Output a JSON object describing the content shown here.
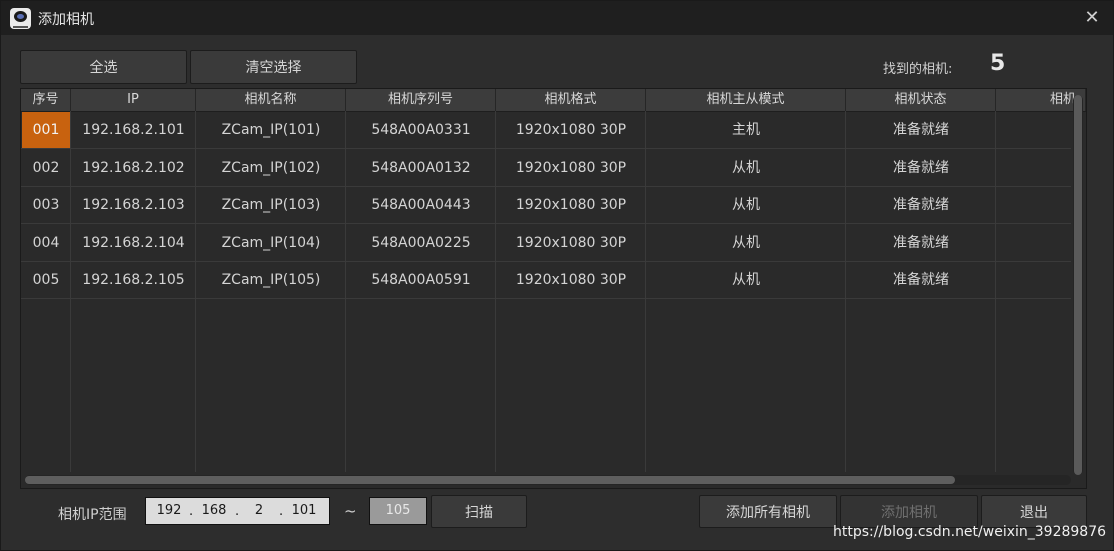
{
  "window": {
    "title": "添加相机",
    "close_glyph": "✕"
  },
  "toolbar": {
    "select_all": "全选",
    "clear_selection": "清空选择"
  },
  "found": {
    "label": "找到的相机:",
    "count": "5"
  },
  "table": {
    "headers": [
      "序号",
      "IP",
      "相机名称",
      "相机序列号",
      "相机格式",
      "相机主从模式",
      "相机状态",
      "相机"
    ],
    "rows": [
      [
        "001",
        "192.168.2.101",
        "ZCam_IP(101)",
        "548A00A0331",
        "1920x1080 30P",
        "主机",
        "准备就绪"
      ],
      [
        "002",
        "192.168.2.102",
        "ZCam_IP(102)",
        "548A00A0132",
        "1920x1080 30P",
        "从机",
        "准备就绪"
      ],
      [
        "003",
        "192.168.2.103",
        "ZCam_IP(103)",
        "548A00A0443",
        "1920x1080 30P",
        "从机",
        "准备就绪"
      ],
      [
        "004",
        "192.168.2.104",
        "ZCam_IP(104)",
        "548A00A0225",
        "1920x1080 30P",
        "从机",
        "准备就绪"
      ],
      [
        "005",
        "192.168.2.105",
        "ZCam_IP(105)",
        "548A00A0591",
        "1920x1080 30P",
        "从机",
        "准备就绪"
      ]
    ],
    "selected_row": 0
  },
  "scan": {
    "label": "相机IP范围",
    "ip": [
      "192",
      "168",
      "2",
      "101"
    ],
    "separator": "~",
    "end": "105",
    "scan_button": "扫描"
  },
  "footer": {
    "add_all": "添加所有相机",
    "add_camera": "添加相机",
    "exit": "退出"
  },
  "watermark": "https://blog.csdn.net/weixin_39289876",
  "colors": {
    "selection": "#c8620f",
    "background": "#2d2d2d",
    "titlebar": "#1f1f1f"
  }
}
